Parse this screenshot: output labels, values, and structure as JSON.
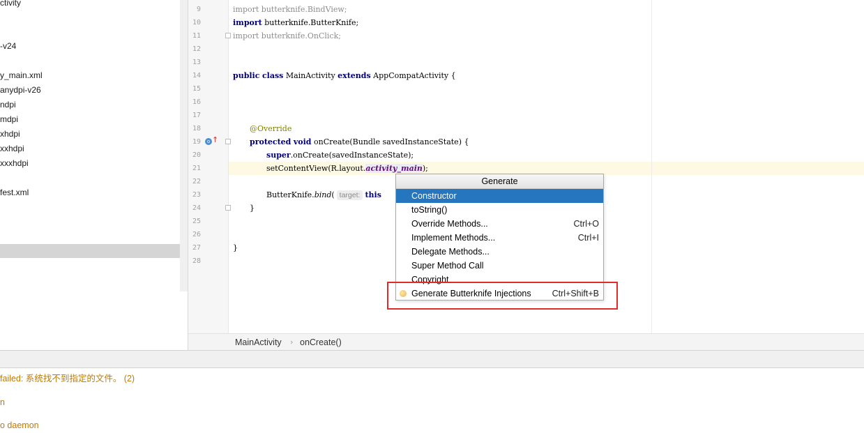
{
  "project_tree": {
    "items": [
      {
        "label": "ctivity"
      },
      {
        "label": "-v24"
      },
      {
        "label": "y_main.xml"
      },
      {
        "label": "anydpi-v26"
      },
      {
        "label": "ndpi"
      },
      {
        "label": "mdpi"
      },
      {
        "label": "xhdpi"
      },
      {
        "label": "xxhdpi"
      },
      {
        "label": "xxxhdpi"
      },
      {
        "label": "fest.xml"
      }
    ]
  },
  "editor": {
    "line_numbers": [
      "9",
      "10",
      "11",
      "12",
      "13",
      "14",
      "15",
      "16",
      "17",
      "18",
      "19",
      "20",
      "21",
      "22",
      "23",
      "24",
      "25",
      "26",
      "27",
      "28"
    ],
    "code": {
      "l9_kw": "import",
      "l9_rest": " butterknife.BindView;",
      "l10_kw": "import",
      "l10_rest": " butterknife.ButterKnife;",
      "l11_kw": "import",
      "l11_rest": " butterknife.OnClick;",
      "l14_kw1": "public",
      "l14_kw2": "class",
      "l14_name": " MainActivity ",
      "l14_kw3": "extends",
      "l14_rest": " AppCompatActivity {",
      "l18_annotation": "@Override",
      "l19_kw1": "protected",
      "l19_kw2": "void",
      "l19_rest": " onCreate(Bundle savedInstanceState) {",
      "l20_kw": "super",
      "l20_rest": ".onCreate(savedInstanceState);",
      "l21_pre": "setContentView(R.layout.",
      "l21_field": "activity_main",
      "l21_post": ");",
      "l23_pre": "ButterKnife.",
      "l23_method": "bind",
      "l23_paren": "(",
      "l23_hint": "target:",
      "l23_kw": "this",
      "l24_brace": "}",
      "l27_brace": "}"
    },
    "gutter_icon_label": "o"
  },
  "breadcrumb": {
    "class_name": "MainActivity",
    "separator": "›",
    "method_name": "onCreate()"
  },
  "generate_popup": {
    "title": "Generate",
    "items": [
      {
        "label": "Constructor",
        "shortcut": "",
        "selected": true
      },
      {
        "label": "toString()",
        "shortcut": ""
      },
      {
        "label": "Override Methods...",
        "shortcut": "Ctrl+O"
      },
      {
        "label": "Implement Methods...",
        "shortcut": "Ctrl+I"
      },
      {
        "label": "Delegate Methods...",
        "shortcut": ""
      },
      {
        "label": "Super Method Call",
        "shortcut": ""
      },
      {
        "label": "Copyright",
        "shortcut": ""
      },
      {
        "label": "Generate Butterknife Injections",
        "shortcut": "Ctrl+Shift+B",
        "icon": "butterknife-icon"
      }
    ],
    "highlight_color": "#e02b2b",
    "selected_color": "#2675bf"
  },
  "console": {
    "lines": [
      "failed: 系统找不到指定的文件。 (2)",
      "n",
      "o daemon"
    ],
    "text_color": "#c07a00"
  }
}
